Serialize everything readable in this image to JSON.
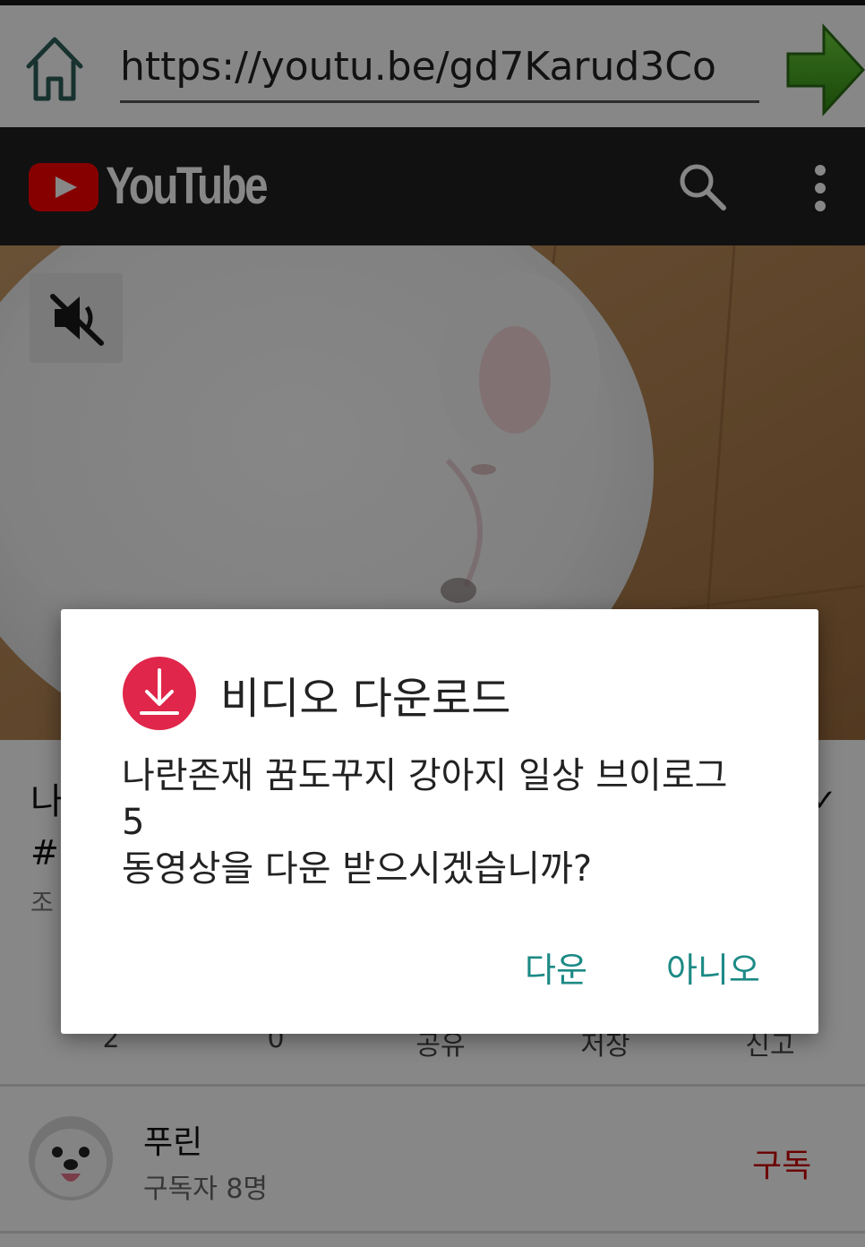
{
  "browser": {
    "url": "https://youtu.be/gd7Karud3Co",
    "home_icon": "home-icon",
    "go_icon": "green-arrow-icon"
  },
  "youtube_header": {
    "wordmark": "YouTube",
    "logo_icon": "youtube-play-logo-icon",
    "search_icon": "search-icon",
    "more_icon": "more-vertical-icon"
  },
  "video": {
    "mute_icon": "volume-off-icon"
  },
  "video_info": {
    "title_fragment": "나",
    "hashtag_fragment": "#",
    "views_fragment": "조",
    "collapse_icon": "chevron-icon",
    "actions": [
      "2",
      "0",
      "공유",
      "저장",
      "신고"
    ]
  },
  "channel": {
    "name": "푸린",
    "subscribers": "구독자 8명",
    "subscribe_label": "구독"
  },
  "dialog": {
    "icon": "download-circle-icon",
    "title": "비디오 다운로드",
    "message_lines": [
      "나란존재 꿈도꾸지 강아지 일상 브이로그",
      "5",
      "동영상을 다운 받으시겠습니까?"
    ],
    "confirm_label": "다운",
    "cancel_label": "아니오",
    "accent_color": "#e0264a",
    "button_color": "#1d8a86"
  }
}
